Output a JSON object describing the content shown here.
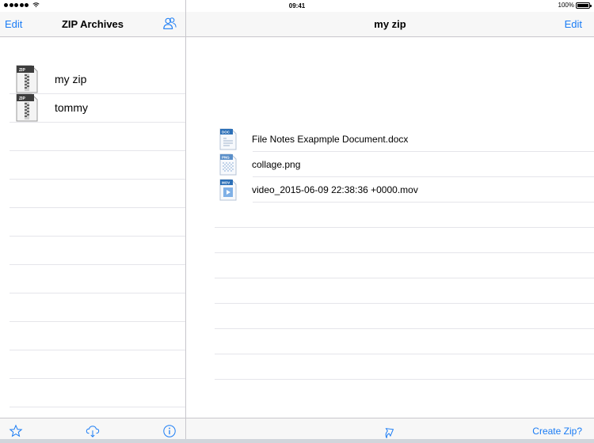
{
  "status_bar": {
    "time": "09:41",
    "battery_percent": "100%",
    "battery_level": 1.0
  },
  "left_pane": {
    "nav": {
      "edit_label": "Edit",
      "title": "ZIP Archives"
    },
    "archives": [
      {
        "label": "my zip",
        "icon": "zip-file-icon",
        "icon_text": "ZIP"
      },
      {
        "label": "tommy",
        "icon": "zip-file-icon",
        "icon_text": "ZIP"
      }
    ],
    "toolbar": {
      "icons": [
        "star-icon",
        "cloud-download-icon",
        "info-icon"
      ]
    }
  },
  "right_pane": {
    "nav": {
      "title": "my zip",
      "edit_label": "Edit"
    },
    "files": [
      {
        "label": "File Notes Exapmple Document.docx",
        "icon": "doc-file-icon",
        "icon_text": "DOC"
      },
      {
        "label": "collage.png",
        "icon": "png-file-icon",
        "icon_text": "PNG"
      },
      {
        "label": "video_2015-06-09 22:38:36 +0000.mov",
        "icon": "movie-file-icon",
        "icon_text": "MOV"
      }
    ],
    "toolbar": {
      "create_zip_label": "Create Zip?",
      "icons": [
        "share-icon"
      ]
    }
  },
  "colors": {
    "accent": "#1a7cf5",
    "separator": "#c8c7cc",
    "bar_bg": "#f7f7f7"
  }
}
